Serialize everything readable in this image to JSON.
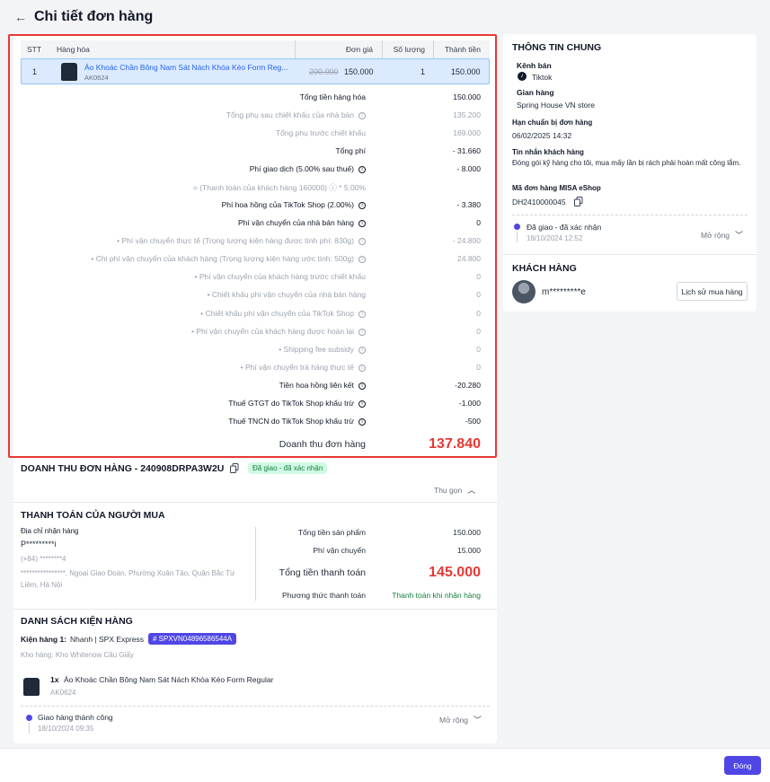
{
  "page": {
    "title": "Chi tiết đơn hàng",
    "close_label": "Đóng"
  },
  "table": {
    "headers": [
      "STT",
      "Hàng hóa",
      "Đơn giá",
      "Số lượng",
      "Thành tiền"
    ],
    "row": {
      "stt": "1",
      "name": "Áo Khoác Chần Bông Nam Sát Nách Khóa Kéo Form Reg...",
      "sku": "AK0624",
      "old_price": "200.000",
      "price": "150.000",
      "qty": "1",
      "total": "150.000"
    }
  },
  "summary": [
    {
      "label": "Tổng tiền hàng hóa",
      "value": "150.000",
      "style": "bold",
      "info": false
    },
    {
      "label": "Tổng phụ sau chiết khấu của nhà bán",
      "value": "135.200",
      "style": "dim",
      "info": true
    },
    {
      "label": "Tổng phụ trước chiết khấu",
      "value": "169.000",
      "style": "dim",
      "info": false
    },
    {
      "label": "Tổng phí",
      "value": "- 31.660",
      "style": "bold",
      "info": false
    },
    {
      "label": "Phí giao dịch (5.00% sau thuế)",
      "value": "- 8.000",
      "style": "bold",
      "info": true
    },
    {
      "label": "= (Thanh toán của khách hàng 160000) ⓘ * 5.00%",
      "value": "",
      "style": "dim",
      "info": false
    },
    {
      "label": "Phí hoa hồng của TikTok Shop (2.00%)",
      "value": "- 3.380",
      "style": "bold",
      "info": true
    },
    {
      "label": "Phí vận chuyển của nhà bán hàng",
      "value": "0",
      "style": "bold",
      "info": true
    },
    {
      "label": "• Phí vận chuyển thực tế (Trọng lượng kiện hàng được tính phí: 830g)",
      "value": "- 24.800",
      "style": "dim",
      "info": true
    },
    {
      "label": "• Chi phí vận chuyển của khách hàng (Trọng lượng kiện hàng ước tính: 500g)",
      "value": "24.800",
      "style": "dim",
      "info": true
    },
    {
      "label": "• Phí vận chuyển của khách hàng trước chiết khấu",
      "value": "0",
      "style": "dim",
      "info": false
    },
    {
      "label": "• Chiết khấu phí vận chuyển của nhà bán hàng",
      "value": "0",
      "style": "dim",
      "info": false
    },
    {
      "label": "• Chiết khấu phí vận chuyển của TikTok Shop",
      "value": "0",
      "style": "dim",
      "info": true
    },
    {
      "label": "• Phí vận chuyển của khách hàng được hoàn lại",
      "value": "0",
      "style": "dim",
      "info": true
    },
    {
      "label": "• Shipping fee subsidy",
      "value": "0",
      "style": "dim",
      "info": true
    },
    {
      "label": "• Phí vận chuyển trả hàng thực tế",
      "value": "0",
      "style": "dim",
      "info": true
    },
    {
      "label": "Tiền hoa hồng liên kết",
      "value": "-20.280",
      "style": "bold",
      "info": true
    },
    {
      "label": "Thuế GTGT do TikTok Shop khấu trừ",
      "value": "-1.000",
      "style": "bold",
      "info": true
    },
    {
      "label": "Thuế TNCN do TikTok Shop khấu trừ",
      "value": "-500",
      "style": "bold",
      "info": true
    }
  ],
  "revenue": {
    "label": "Doanh thu đơn hàng",
    "value": "137.840"
  },
  "order_revenue": {
    "title": "DOANH THU ĐƠN HÀNG - 240908DRPA3W2U",
    "status": "Đã giao - đã xác nhận",
    "collapse": "Thu gọn"
  },
  "buyer_payment": {
    "title": "THANH TOÁN CỦA NGƯỜI MUA",
    "address_label": "Địa chỉ nhận hàng",
    "name": "P*********i",
    "phone": "(+84) ********4",
    "address": "****************, Ngoại Giao Đoàn, Phường Xuân Tảo, Quận Bắc Từ Liêm, Hà Nội",
    "rows": [
      {
        "label": "Tổng tiền sản phẩm",
        "value": "150.000"
      },
      {
        "label": "Phí vận chuyển",
        "value": "15.000"
      }
    ],
    "total_label": "Tổng tiền thanh toán",
    "total_value": "145.000",
    "method_label": "Phương thức thanh toán",
    "method_value": "Thanh toán khi nhận hàng"
  },
  "packages": {
    "title": "DANH SÁCH KIỆN HÀNG",
    "pkg_label": "Kiện hàng 1:",
    "carrier": "Nhanh | SPX Express",
    "tracking": "# SPXVN04896586544A",
    "warehouse": "Kho hàng: Kho Whitenow Cầu Giấy",
    "item_qty": "1x",
    "item_name": "Áo Khoác Chần Bông Nam Sát Nách Khóa Kéo Form Regular",
    "item_sku": "AK0624",
    "status": "Giao hàng thành công",
    "status_time": "18/10/2024 09:35",
    "expand": "Mở rộng"
  },
  "general": {
    "title": "THÔNG TIN CHUNG",
    "channel_label": "Kênh bán",
    "channel": "Tiktok",
    "shop_label": "Gian hàng",
    "shop": "Spring House VN store",
    "deadline_label": "Hạn chuẩn bị đơn hàng",
    "deadline": "06/02/2025 14:32",
    "message_label": "Tin nhắn khách hàng",
    "message": "Đóng gói kỹ hàng cho tôi, mua mấy lần bị rách phải hoàn mất công lắm.",
    "misa_label": "Mã đơn hàng MISA eShop",
    "misa": "DH2410000045",
    "status": "Đã giao - đã xác nhận",
    "status_time": "18/10/2024 12:52",
    "expand": "Mở rộng"
  },
  "customer": {
    "title": "KHÁCH HÀNG",
    "name": "m*********e",
    "history": "Lịch sử mua hàng"
  }
}
